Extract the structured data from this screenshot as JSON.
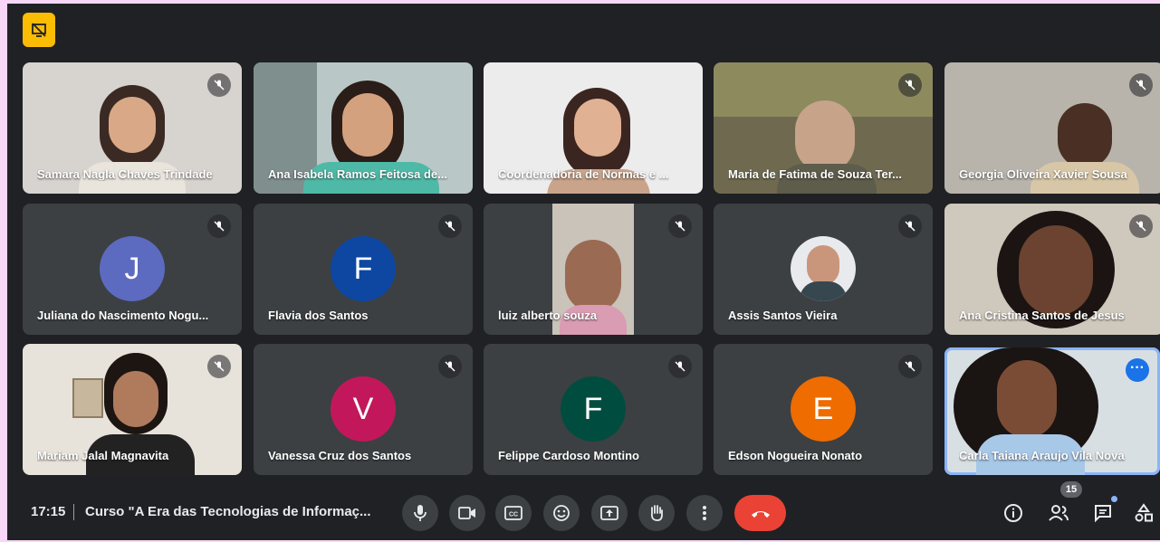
{
  "meeting": {
    "time": "17:15",
    "title": "Curso \"A Era das Tecnologias de Informaç...",
    "participant_count": "15"
  },
  "participants": [
    {
      "name": "Samara Nagla Chaves Trindade",
      "muted": true,
      "video": "photo"
    },
    {
      "name": "Ana Isabela Ramos Feitosa de...",
      "muted": false,
      "video": "photo"
    },
    {
      "name": "Coordenadoria de Normas e ...",
      "muted": false,
      "video": "photo"
    },
    {
      "name": "Maria de Fatima de Souza Ter...",
      "muted": true,
      "video": "photo"
    },
    {
      "name": "Georgia Oliveira Xavier Sousa",
      "muted": true,
      "video": "photo"
    },
    {
      "name": "Juliana do Nascimento Nogu...",
      "muted": true,
      "avatar_letter": "J",
      "avatar_color": "#5c6bc0"
    },
    {
      "name": "Flavia dos Santos",
      "muted": true,
      "avatar_letter": "F",
      "avatar_color": "#0d47a1"
    },
    {
      "name": "luiz alberto souza",
      "muted": true,
      "video": "photo"
    },
    {
      "name": "Assis Santos Vieira",
      "muted": true,
      "avatar": "profile-photo"
    },
    {
      "name": "Ana Cristina Santos de Jesus",
      "muted": true,
      "video": "photo"
    },
    {
      "name": "Mariam Jalal Magnavita",
      "muted": true,
      "video": "photo"
    },
    {
      "name": "Vanessa Cruz dos Santos",
      "muted": true,
      "avatar_letter": "V",
      "avatar_color": "#c2185b"
    },
    {
      "name": "Felippe Cardoso Montino",
      "muted": true,
      "avatar_letter": "F",
      "avatar_color": "#004d40"
    },
    {
      "name": "Edson Nogueira Nonato",
      "muted": true,
      "avatar_letter": "E",
      "avatar_color": "#ef6c00"
    },
    {
      "name": "Carla Taiana Araujo Vila Nova",
      "muted": false,
      "video": "photo",
      "active_speaker": true
    }
  ],
  "controls": {
    "buttons": [
      "mic-icon",
      "camera-icon",
      "captions-icon",
      "emoji-icon",
      "present-icon",
      "raise-hand-icon",
      "more-options-icon",
      "end-call-icon"
    ],
    "right": [
      "info-icon",
      "people-icon",
      "chat-icon",
      "activities-icon"
    ]
  },
  "colors": {
    "accent": "#8ab4f8",
    "end_call": "#ea4335",
    "badge": "#fbbc04"
  }
}
